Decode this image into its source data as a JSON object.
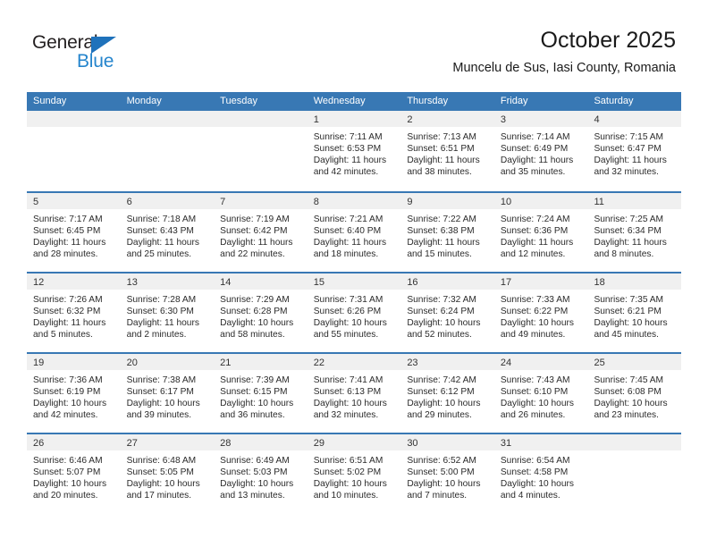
{
  "brand": {
    "line1": "General",
    "line2": "Blue",
    "triangle_color": "#1f72bb",
    "blue_color": "#2585cd"
  },
  "header": {
    "title": "October 2025",
    "subtitle": "Muncelu de Sus, Iasi County, Romania"
  },
  "theme": {
    "header_blue": "#3878b4",
    "cell_head_gray": "#f0f0f0",
    "text": "#2b2b2b"
  },
  "calendar": {
    "weekday_headers": [
      "Sunday",
      "Monday",
      "Tuesday",
      "Wednesday",
      "Thursday",
      "Friday",
      "Saturday"
    ],
    "weeks": [
      [
        {
          "day": "",
          "lines": []
        },
        {
          "day": "",
          "lines": []
        },
        {
          "day": "",
          "lines": []
        },
        {
          "day": "1",
          "lines": [
            "Sunrise: 7:11 AM",
            "Sunset: 6:53 PM",
            "Daylight: 11 hours",
            "and 42 minutes."
          ]
        },
        {
          "day": "2",
          "lines": [
            "Sunrise: 7:13 AM",
            "Sunset: 6:51 PM",
            "Daylight: 11 hours",
            "and 38 minutes."
          ]
        },
        {
          "day": "3",
          "lines": [
            "Sunrise: 7:14 AM",
            "Sunset: 6:49 PM",
            "Daylight: 11 hours",
            "and 35 minutes."
          ]
        },
        {
          "day": "4",
          "lines": [
            "Sunrise: 7:15 AM",
            "Sunset: 6:47 PM",
            "Daylight: 11 hours",
            "and 32 minutes."
          ]
        }
      ],
      [
        {
          "day": "5",
          "lines": [
            "Sunrise: 7:17 AM",
            "Sunset: 6:45 PM",
            "Daylight: 11 hours",
            "and 28 minutes."
          ]
        },
        {
          "day": "6",
          "lines": [
            "Sunrise: 7:18 AM",
            "Sunset: 6:43 PM",
            "Daylight: 11 hours",
            "and 25 minutes."
          ]
        },
        {
          "day": "7",
          "lines": [
            "Sunrise: 7:19 AM",
            "Sunset: 6:42 PM",
            "Daylight: 11 hours",
            "and 22 minutes."
          ]
        },
        {
          "day": "8",
          "lines": [
            "Sunrise: 7:21 AM",
            "Sunset: 6:40 PM",
            "Daylight: 11 hours",
            "and 18 minutes."
          ]
        },
        {
          "day": "9",
          "lines": [
            "Sunrise: 7:22 AM",
            "Sunset: 6:38 PM",
            "Daylight: 11 hours",
            "and 15 minutes."
          ]
        },
        {
          "day": "10",
          "lines": [
            "Sunrise: 7:24 AM",
            "Sunset: 6:36 PM",
            "Daylight: 11 hours",
            "and 12 minutes."
          ]
        },
        {
          "day": "11",
          "lines": [
            "Sunrise: 7:25 AM",
            "Sunset: 6:34 PM",
            "Daylight: 11 hours",
            "and 8 minutes."
          ]
        }
      ],
      [
        {
          "day": "12",
          "lines": [
            "Sunrise: 7:26 AM",
            "Sunset: 6:32 PM",
            "Daylight: 11 hours",
            "and 5 minutes."
          ]
        },
        {
          "day": "13",
          "lines": [
            "Sunrise: 7:28 AM",
            "Sunset: 6:30 PM",
            "Daylight: 11 hours",
            "and 2 minutes."
          ]
        },
        {
          "day": "14",
          "lines": [
            "Sunrise: 7:29 AM",
            "Sunset: 6:28 PM",
            "Daylight: 10 hours",
            "and 58 minutes."
          ]
        },
        {
          "day": "15",
          "lines": [
            "Sunrise: 7:31 AM",
            "Sunset: 6:26 PM",
            "Daylight: 10 hours",
            "and 55 minutes."
          ]
        },
        {
          "day": "16",
          "lines": [
            "Sunrise: 7:32 AM",
            "Sunset: 6:24 PM",
            "Daylight: 10 hours",
            "and 52 minutes."
          ]
        },
        {
          "day": "17",
          "lines": [
            "Sunrise: 7:33 AM",
            "Sunset: 6:22 PM",
            "Daylight: 10 hours",
            "and 49 minutes."
          ]
        },
        {
          "day": "18",
          "lines": [
            "Sunrise: 7:35 AM",
            "Sunset: 6:21 PM",
            "Daylight: 10 hours",
            "and 45 minutes."
          ]
        }
      ],
      [
        {
          "day": "19",
          "lines": [
            "Sunrise: 7:36 AM",
            "Sunset: 6:19 PM",
            "Daylight: 10 hours",
            "and 42 minutes."
          ]
        },
        {
          "day": "20",
          "lines": [
            "Sunrise: 7:38 AM",
            "Sunset: 6:17 PM",
            "Daylight: 10 hours",
            "and 39 minutes."
          ]
        },
        {
          "day": "21",
          "lines": [
            "Sunrise: 7:39 AM",
            "Sunset: 6:15 PM",
            "Daylight: 10 hours",
            "and 36 minutes."
          ]
        },
        {
          "day": "22",
          "lines": [
            "Sunrise: 7:41 AM",
            "Sunset: 6:13 PM",
            "Daylight: 10 hours",
            "and 32 minutes."
          ]
        },
        {
          "day": "23",
          "lines": [
            "Sunrise: 7:42 AM",
            "Sunset: 6:12 PM",
            "Daylight: 10 hours",
            "and 29 minutes."
          ]
        },
        {
          "day": "24",
          "lines": [
            "Sunrise: 7:43 AM",
            "Sunset: 6:10 PM",
            "Daylight: 10 hours",
            "and 26 minutes."
          ]
        },
        {
          "day": "25",
          "lines": [
            "Sunrise: 7:45 AM",
            "Sunset: 6:08 PM",
            "Daylight: 10 hours",
            "and 23 minutes."
          ]
        }
      ],
      [
        {
          "day": "26",
          "lines": [
            "Sunrise: 6:46 AM",
            "Sunset: 5:07 PM",
            "Daylight: 10 hours",
            "and 20 minutes."
          ]
        },
        {
          "day": "27",
          "lines": [
            "Sunrise: 6:48 AM",
            "Sunset: 5:05 PM",
            "Daylight: 10 hours",
            "and 17 minutes."
          ]
        },
        {
          "day": "28",
          "lines": [
            "Sunrise: 6:49 AM",
            "Sunset: 5:03 PM",
            "Daylight: 10 hours",
            "and 13 minutes."
          ]
        },
        {
          "day": "29",
          "lines": [
            "Sunrise: 6:51 AM",
            "Sunset: 5:02 PM",
            "Daylight: 10 hours",
            "and 10 minutes."
          ]
        },
        {
          "day": "30",
          "lines": [
            "Sunrise: 6:52 AM",
            "Sunset: 5:00 PM",
            "Daylight: 10 hours",
            "and 7 minutes."
          ]
        },
        {
          "day": "31",
          "lines": [
            "Sunrise: 6:54 AM",
            "Sunset: 4:58 PM",
            "Daylight: 10 hours",
            "and 4 minutes."
          ]
        },
        {
          "day": "",
          "lines": []
        }
      ]
    ]
  }
}
